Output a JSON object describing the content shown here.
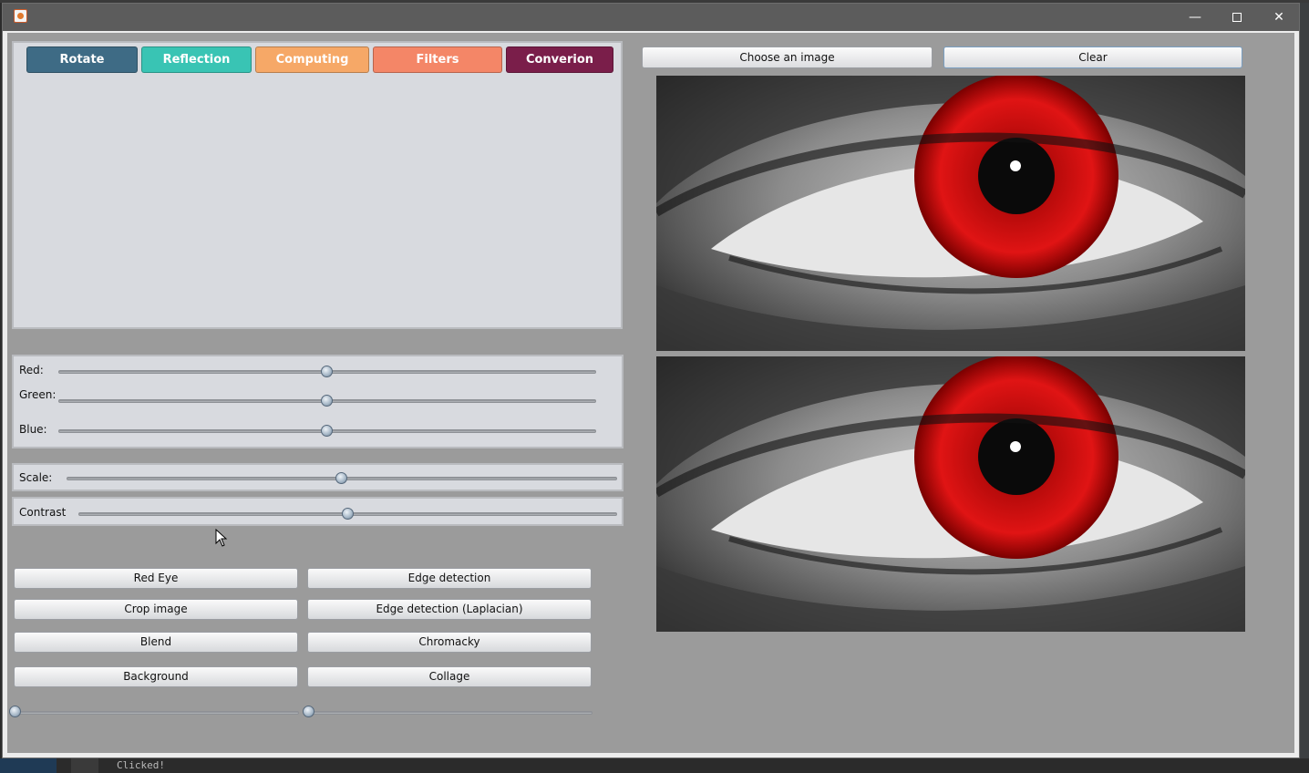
{
  "tabs": [
    {
      "label": "Rotate",
      "color": "#3e6b85"
    },
    {
      "label": "Reflection",
      "color": "#39c4b4"
    },
    {
      "label": "Computing",
      "color": "#f6a867"
    },
    {
      "label": "Filters",
      "color": "#f48667"
    },
    {
      "label": "Converion",
      "color": "#7a1e4a"
    }
  ],
  "color_sliders": [
    {
      "label": "Red:",
      "value": 50
    },
    {
      "label": "Green:",
      "value": 50
    },
    {
      "label": "Blue:",
      "value": 50
    }
  ],
  "scale_slider": {
    "label": "Scale:",
    "value": 50
  },
  "contrast_slider": {
    "label": "Contrast",
    "value": 50
  },
  "buttons": {
    "red_eye": "Red Eye",
    "edge_detection": "Edge detection",
    "crop_image": "Crop image",
    "edge_laplacian": "Edge detection (Laplacian)",
    "blend": "Blend",
    "chromacky": "Chromacky",
    "background": "Background",
    "collage": "Collage"
  },
  "bottom_sliders": [
    {
      "value": 0
    },
    {
      "value": 0
    }
  ],
  "top_buttons": {
    "choose_image": "Choose an image",
    "clear": "Clear"
  },
  "images": [
    {
      "icon": "red-eye-photo-original"
    },
    {
      "icon": "red-eye-photo-processed"
    }
  ],
  "console": {
    "text": "Clicked!"
  },
  "window": {
    "min": "—",
    "close": "✕"
  }
}
